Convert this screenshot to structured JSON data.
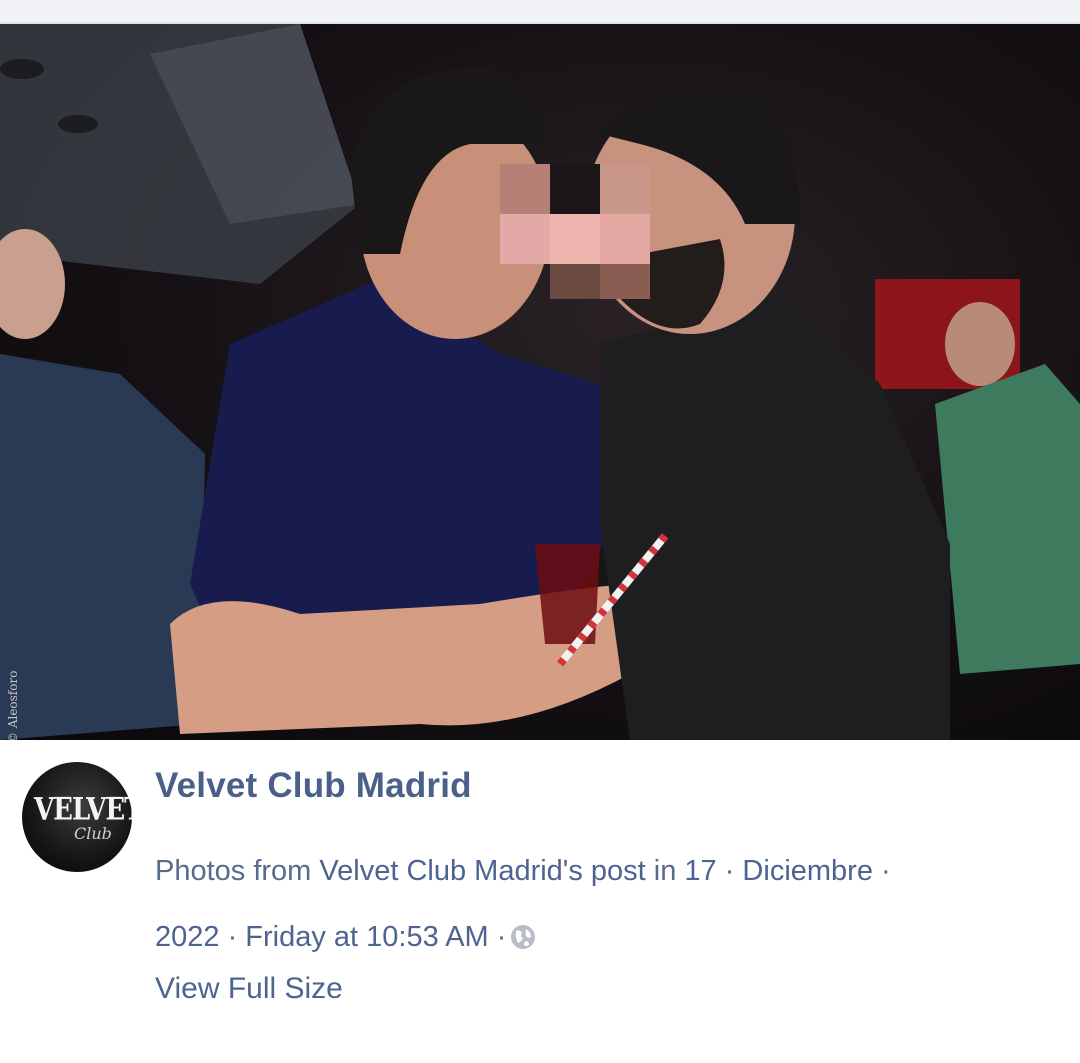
{
  "photo": {
    "watermark": "© Aleosforo",
    "alt_description": "Two men at a nightclub"
  },
  "post": {
    "page_name": "Velvet Club Madrid",
    "avatar": {
      "logo_text": "VELVET",
      "logo_script": "Club"
    },
    "meta": {
      "line1_prefix": "Photos from ",
      "line1_link": "Velvet Club Madrid's post",
      "line1_mid": " in ",
      "line1_album": "17 · Diciembre ·",
      "line2_album_end": "2022",
      "separator": " · ",
      "timestamp": "Friday at 10:53 AM",
      "separator2": " ·"
    },
    "audience_icon": "globe-icon",
    "view_full_size": "View Full Size"
  },
  "colors": {
    "page_name": "#4b6088",
    "link": "#4d6491",
    "meta": "#5a6a8a"
  }
}
